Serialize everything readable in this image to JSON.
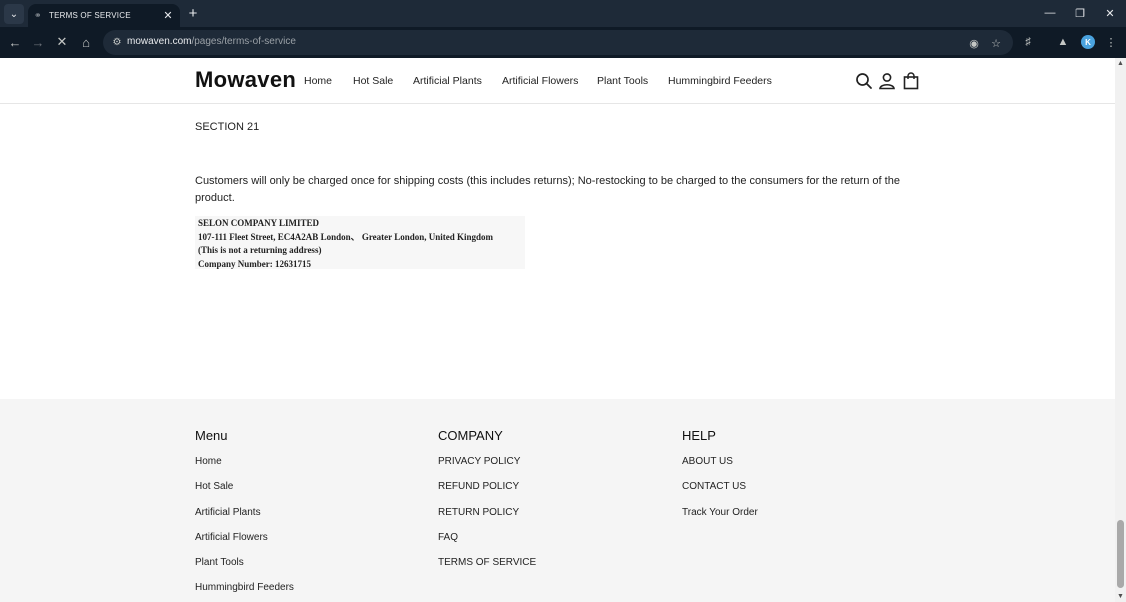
{
  "browser": {
    "tab_title": "TERMS OF SERVICE",
    "url_domain": "mowaven.com",
    "url_path": "/pages/terms-of-service",
    "profile_initial": "K"
  },
  "site": {
    "logo": "Mowaven",
    "nav": [
      "Home",
      "Hot Sale",
      "Artificial Plants",
      "Artificial Flowers",
      "Plant Tools",
      "Hummingbird Feeders"
    ]
  },
  "content": {
    "section_title": "SECTION 21",
    "paragraph": "Customers will only be charged once for shipping costs (this includes returns); No-restocking to be charged to the consumers for the return of the product.",
    "company_lines": [
      "SELON COMPANY LIMITED",
      "107-111 Fleet Street, EC4A2AB London、 Greater London, United Kingdom",
      "(This is not a returning address)",
      "Company Number: 12631715"
    ]
  },
  "footer": {
    "columns": [
      {
        "heading": "Menu",
        "links": [
          "Home",
          "Hot Sale",
          "Artificial Plants",
          "Artificial Flowers",
          "Plant Tools",
          "Hummingbird Feeders"
        ]
      },
      {
        "heading": "COMPANY",
        "links": [
          "PRIVACY POLICY",
          "REFUND POLICY",
          "RETURN POLICY",
          "FAQ",
          "TERMS OF SERVICE"
        ]
      },
      {
        "heading": "HELP",
        "links": [
          "ABOUT US",
          "CONTACT US",
          "Track Your Order"
        ]
      }
    ]
  }
}
